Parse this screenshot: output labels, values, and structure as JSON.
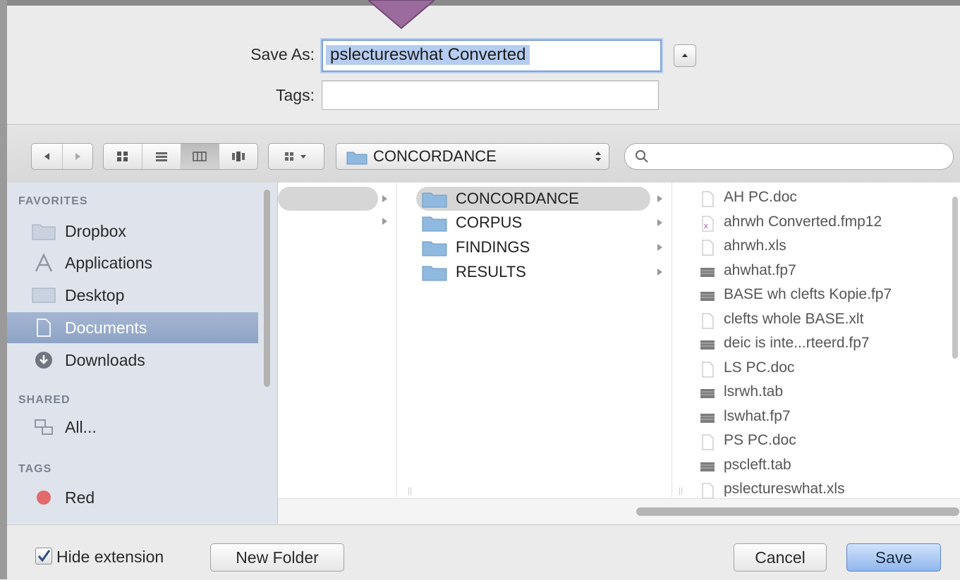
{
  "dialog": {
    "save_as_label": "Save As:",
    "save_as_value": "pslectureswhat Converted",
    "tags_label": "Tags:",
    "tags_value": ""
  },
  "toolbar": {
    "location": "CONCORDANCE",
    "search_placeholder": "",
    "view_modes": [
      "icon",
      "list",
      "column",
      "cover-flow"
    ],
    "active_view": "column"
  },
  "sidebar": {
    "favorites_header": "FAVORITES",
    "favorites": [
      {
        "label": "Dropbox",
        "icon": "folder-icon"
      },
      {
        "label": "Applications",
        "icon": "applications-icon"
      },
      {
        "label": "Desktop",
        "icon": "desktop-icon"
      },
      {
        "label": "Documents",
        "icon": "documents-icon",
        "selected": true
      },
      {
        "label": "Downloads",
        "icon": "downloads-icon"
      }
    ],
    "shared_header": "SHARED",
    "shared": [
      {
        "label": "All...",
        "icon": "network-icon"
      }
    ],
    "tags_header": "TAGS",
    "tags": [
      {
        "label": "Red",
        "color": "#e26a6a"
      }
    ]
  },
  "browser": {
    "folders": [
      {
        "label": "CONCORDANCE",
        "selected": true
      },
      {
        "label": "CORPUS"
      },
      {
        "label": "FINDINGS"
      },
      {
        "label": "RESULTS"
      }
    ],
    "files": [
      {
        "label": "AH PC.doc",
        "type": "doc"
      },
      {
        "label": "ahrwh Converted.fmp12",
        "type": "fmp"
      },
      {
        "label": "ahrwh.xls",
        "type": "doc"
      },
      {
        "label": "ahwhat.fp7",
        "type": "db"
      },
      {
        "label": "BASE wh clefts Kopie.fp7",
        "type": "db"
      },
      {
        "label": "clefts whole BASE.xlt",
        "type": "doc"
      },
      {
        "label": "deic is inte...rteerd.fp7",
        "type": "db"
      },
      {
        "label": "LS PC.doc",
        "type": "doc"
      },
      {
        "label": "lsrwh.tab",
        "type": "db"
      },
      {
        "label": "lswhat.fp7",
        "type": "db"
      },
      {
        "label": "PS PC.doc",
        "type": "doc"
      },
      {
        "label": "pscleft.tab",
        "type": "db"
      },
      {
        "label": "pslectureswhat.xls",
        "type": "doc"
      }
    ]
  },
  "footer": {
    "hide_extension_label": "Hide extension",
    "hide_extension_checked": true,
    "new_folder_label": "New Folder",
    "cancel_label": "Cancel",
    "save_label": "Save"
  },
  "colors": {
    "accent": "#8fb6ec",
    "selection": "#b5cdf0",
    "sidebar_bg": "#dfe4ec",
    "notch": "#9c6b9e"
  }
}
